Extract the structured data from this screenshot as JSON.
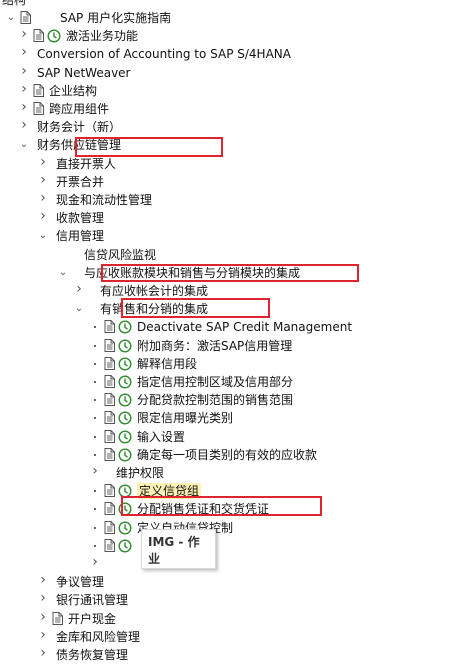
{
  "header": {
    "title": "结构"
  },
  "tree": [
    {
      "label": "SAP 用户化实施指南",
      "depth": 0,
      "arrow": "down",
      "doc": true,
      "clock": false
    },
    {
      "label": "激活业务功能",
      "depth": 1,
      "arrow": "right",
      "doc": true,
      "clock": true
    },
    {
      "label": "Conversion of Accounting to SAP S/4HANA",
      "depth": 1,
      "arrow": "right",
      "doc": false,
      "clock": false
    },
    {
      "label": "SAP NetWeaver",
      "depth": 1,
      "arrow": "right",
      "doc": false,
      "clock": false
    },
    {
      "label": "企业结构",
      "depth": 1,
      "arrow": "right",
      "doc": true,
      "clock": false
    },
    {
      "label": "跨应用组件",
      "depth": 1,
      "arrow": "right",
      "doc": true,
      "clock": false
    },
    {
      "label": "财务会计（新）",
      "depth": 1,
      "arrow": "right",
      "doc": false,
      "clock": false
    },
    {
      "label": "财务供应链管理",
      "depth": 1,
      "arrow": "down",
      "doc": false,
      "clock": false
    },
    {
      "label": "直接开票人",
      "depth": 2,
      "arrow": "right",
      "doc": false,
      "clock": false
    },
    {
      "label": "开票合并",
      "depth": 2,
      "arrow": "right",
      "doc": false,
      "clock": false
    },
    {
      "label": "现金和流动性管理",
      "depth": 2,
      "arrow": "right",
      "doc": false,
      "clock": false
    },
    {
      "label": "收款管理",
      "depth": 2,
      "arrow": "right",
      "doc": false,
      "clock": false
    },
    {
      "label": "信用管理",
      "depth": 2,
      "arrow": "down",
      "doc": false,
      "clock": false
    },
    {
      "label": "信贷风险监视",
      "depth": 3,
      "arrow": "none",
      "doc": false,
      "clock": false
    },
    {
      "label": "与应收账款模块和销售与分销模块的集成",
      "depth": 3,
      "arrow": "down",
      "doc": false,
      "clock": false
    },
    {
      "label": "有应收帐会计的集成",
      "depth": 4,
      "arrow": "right",
      "doc": false,
      "clock": false
    },
    {
      "label": "有销售和分销的集成",
      "depth": 4,
      "arrow": "down",
      "doc": false,
      "clock": false
    },
    {
      "label": "Deactivate SAP Credit Management",
      "depth": 5,
      "arrow": "bullet",
      "doc": true,
      "clock": true
    },
    {
      "label": "附加商务：激活SAP信用管理",
      "depth": 5,
      "arrow": "bullet",
      "doc": true,
      "clock": true
    },
    {
      "label": "解释信用段",
      "depth": 5,
      "arrow": "bullet",
      "doc": true,
      "clock": true
    },
    {
      "label": "指定信用控制区域及信用部分",
      "depth": 5,
      "arrow": "bullet",
      "doc": true,
      "clock": true
    },
    {
      "label": "分配贷款控制范围的销售范围",
      "depth": 5,
      "arrow": "bullet",
      "doc": true,
      "clock": true
    },
    {
      "label": "限定信用曝光类别",
      "depth": 5,
      "arrow": "bullet",
      "doc": true,
      "clock": true
    },
    {
      "label": "输入设置",
      "depth": 5,
      "arrow": "bullet",
      "doc": true,
      "clock": true
    },
    {
      "label": "确定每一项目类别的有效的应收款",
      "depth": 5,
      "arrow": "bullet",
      "doc": true,
      "clock": true
    },
    {
      "label": "维护权限",
      "depth": 5,
      "arrow": "right",
      "doc": false,
      "clock": false
    },
    {
      "label": "定义信贷组",
      "depth": 5,
      "arrow": "bullet",
      "doc": true,
      "clock": true,
      "highlight": true
    },
    {
      "label": "分配销售凭证和交货凭证",
      "depth": 5,
      "arrow": "bullet",
      "doc": true,
      "clock": true
    },
    {
      "label": "定义自动信贷控制",
      "depth": 5,
      "arrow": "bullet",
      "doc": true,
      "clock": true
    },
    {
      "label": "",
      "depth": 5,
      "arrow": "bullet",
      "doc": true,
      "clock": true
    },
    {
      "label": "",
      "depth": 5,
      "arrow": "right",
      "doc": false,
      "clock": false
    },
    {
      "label": "争议管理",
      "depth": 2,
      "arrow": "right",
      "doc": false,
      "clock": false
    },
    {
      "label": "银行通讯管理",
      "depth": 2,
      "arrow": "right",
      "doc": false,
      "clock": false
    },
    {
      "label": "开户现金",
      "depth": 2,
      "arrow": "right",
      "doc": true,
      "clock": false
    },
    {
      "label": "金库和风险管理",
      "depth": 2,
      "arrow": "right",
      "doc": false,
      "clock": false
    },
    {
      "label": "债务恢复管理",
      "depth": 2,
      "arrow": "right",
      "doc": false,
      "clock": false
    }
  ],
  "tooltip": {
    "text": "IMG - 作业"
  },
  "colors": {
    "highlight_box": "#e0242f",
    "selected_bg": "#fff2b5",
    "clock_green": "#2e8b2e"
  }
}
